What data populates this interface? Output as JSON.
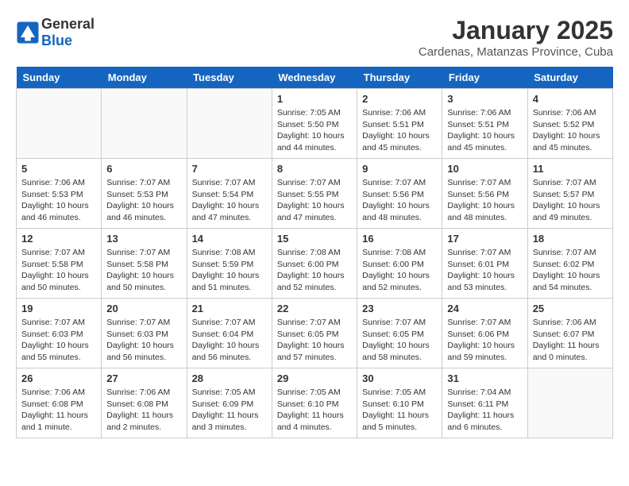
{
  "header": {
    "logo": {
      "general": "General",
      "blue": "Blue"
    },
    "title": "January 2025",
    "location": "Cardenas, Matanzas Province, Cuba"
  },
  "weekdays": [
    "Sunday",
    "Monday",
    "Tuesday",
    "Wednesday",
    "Thursday",
    "Friday",
    "Saturday"
  ],
  "weeks": [
    [
      {
        "day": "",
        "info": ""
      },
      {
        "day": "",
        "info": ""
      },
      {
        "day": "",
        "info": ""
      },
      {
        "day": "1",
        "info": "Sunrise: 7:05 AM\nSunset: 5:50 PM\nDaylight: 10 hours\nand 44 minutes."
      },
      {
        "day": "2",
        "info": "Sunrise: 7:06 AM\nSunset: 5:51 PM\nDaylight: 10 hours\nand 45 minutes."
      },
      {
        "day": "3",
        "info": "Sunrise: 7:06 AM\nSunset: 5:51 PM\nDaylight: 10 hours\nand 45 minutes."
      },
      {
        "day": "4",
        "info": "Sunrise: 7:06 AM\nSunset: 5:52 PM\nDaylight: 10 hours\nand 45 minutes."
      }
    ],
    [
      {
        "day": "5",
        "info": "Sunrise: 7:06 AM\nSunset: 5:53 PM\nDaylight: 10 hours\nand 46 minutes."
      },
      {
        "day": "6",
        "info": "Sunrise: 7:07 AM\nSunset: 5:53 PM\nDaylight: 10 hours\nand 46 minutes."
      },
      {
        "day": "7",
        "info": "Sunrise: 7:07 AM\nSunset: 5:54 PM\nDaylight: 10 hours\nand 47 minutes."
      },
      {
        "day": "8",
        "info": "Sunrise: 7:07 AM\nSunset: 5:55 PM\nDaylight: 10 hours\nand 47 minutes."
      },
      {
        "day": "9",
        "info": "Sunrise: 7:07 AM\nSunset: 5:56 PM\nDaylight: 10 hours\nand 48 minutes."
      },
      {
        "day": "10",
        "info": "Sunrise: 7:07 AM\nSunset: 5:56 PM\nDaylight: 10 hours\nand 48 minutes."
      },
      {
        "day": "11",
        "info": "Sunrise: 7:07 AM\nSunset: 5:57 PM\nDaylight: 10 hours\nand 49 minutes."
      }
    ],
    [
      {
        "day": "12",
        "info": "Sunrise: 7:07 AM\nSunset: 5:58 PM\nDaylight: 10 hours\nand 50 minutes."
      },
      {
        "day": "13",
        "info": "Sunrise: 7:07 AM\nSunset: 5:58 PM\nDaylight: 10 hours\nand 50 minutes."
      },
      {
        "day": "14",
        "info": "Sunrise: 7:08 AM\nSunset: 5:59 PM\nDaylight: 10 hours\nand 51 minutes."
      },
      {
        "day": "15",
        "info": "Sunrise: 7:08 AM\nSunset: 6:00 PM\nDaylight: 10 hours\nand 52 minutes."
      },
      {
        "day": "16",
        "info": "Sunrise: 7:08 AM\nSunset: 6:00 PM\nDaylight: 10 hours\nand 52 minutes."
      },
      {
        "day": "17",
        "info": "Sunrise: 7:07 AM\nSunset: 6:01 PM\nDaylight: 10 hours\nand 53 minutes."
      },
      {
        "day": "18",
        "info": "Sunrise: 7:07 AM\nSunset: 6:02 PM\nDaylight: 10 hours\nand 54 minutes."
      }
    ],
    [
      {
        "day": "19",
        "info": "Sunrise: 7:07 AM\nSunset: 6:03 PM\nDaylight: 10 hours\nand 55 minutes."
      },
      {
        "day": "20",
        "info": "Sunrise: 7:07 AM\nSunset: 6:03 PM\nDaylight: 10 hours\nand 56 minutes."
      },
      {
        "day": "21",
        "info": "Sunrise: 7:07 AM\nSunset: 6:04 PM\nDaylight: 10 hours\nand 56 minutes."
      },
      {
        "day": "22",
        "info": "Sunrise: 7:07 AM\nSunset: 6:05 PM\nDaylight: 10 hours\nand 57 minutes."
      },
      {
        "day": "23",
        "info": "Sunrise: 7:07 AM\nSunset: 6:05 PM\nDaylight: 10 hours\nand 58 minutes."
      },
      {
        "day": "24",
        "info": "Sunrise: 7:07 AM\nSunset: 6:06 PM\nDaylight: 10 hours\nand 59 minutes."
      },
      {
        "day": "25",
        "info": "Sunrise: 7:06 AM\nSunset: 6:07 PM\nDaylight: 11 hours\nand 0 minutes."
      }
    ],
    [
      {
        "day": "26",
        "info": "Sunrise: 7:06 AM\nSunset: 6:08 PM\nDaylight: 11 hours\nand 1 minute."
      },
      {
        "day": "27",
        "info": "Sunrise: 7:06 AM\nSunset: 6:08 PM\nDaylight: 11 hours\nand 2 minutes."
      },
      {
        "day": "28",
        "info": "Sunrise: 7:05 AM\nSunset: 6:09 PM\nDaylight: 11 hours\nand 3 minutes."
      },
      {
        "day": "29",
        "info": "Sunrise: 7:05 AM\nSunset: 6:10 PM\nDaylight: 11 hours\nand 4 minutes."
      },
      {
        "day": "30",
        "info": "Sunrise: 7:05 AM\nSunset: 6:10 PM\nDaylight: 11 hours\nand 5 minutes."
      },
      {
        "day": "31",
        "info": "Sunrise: 7:04 AM\nSunset: 6:11 PM\nDaylight: 11 hours\nand 6 minutes."
      },
      {
        "day": "",
        "info": ""
      }
    ]
  ]
}
